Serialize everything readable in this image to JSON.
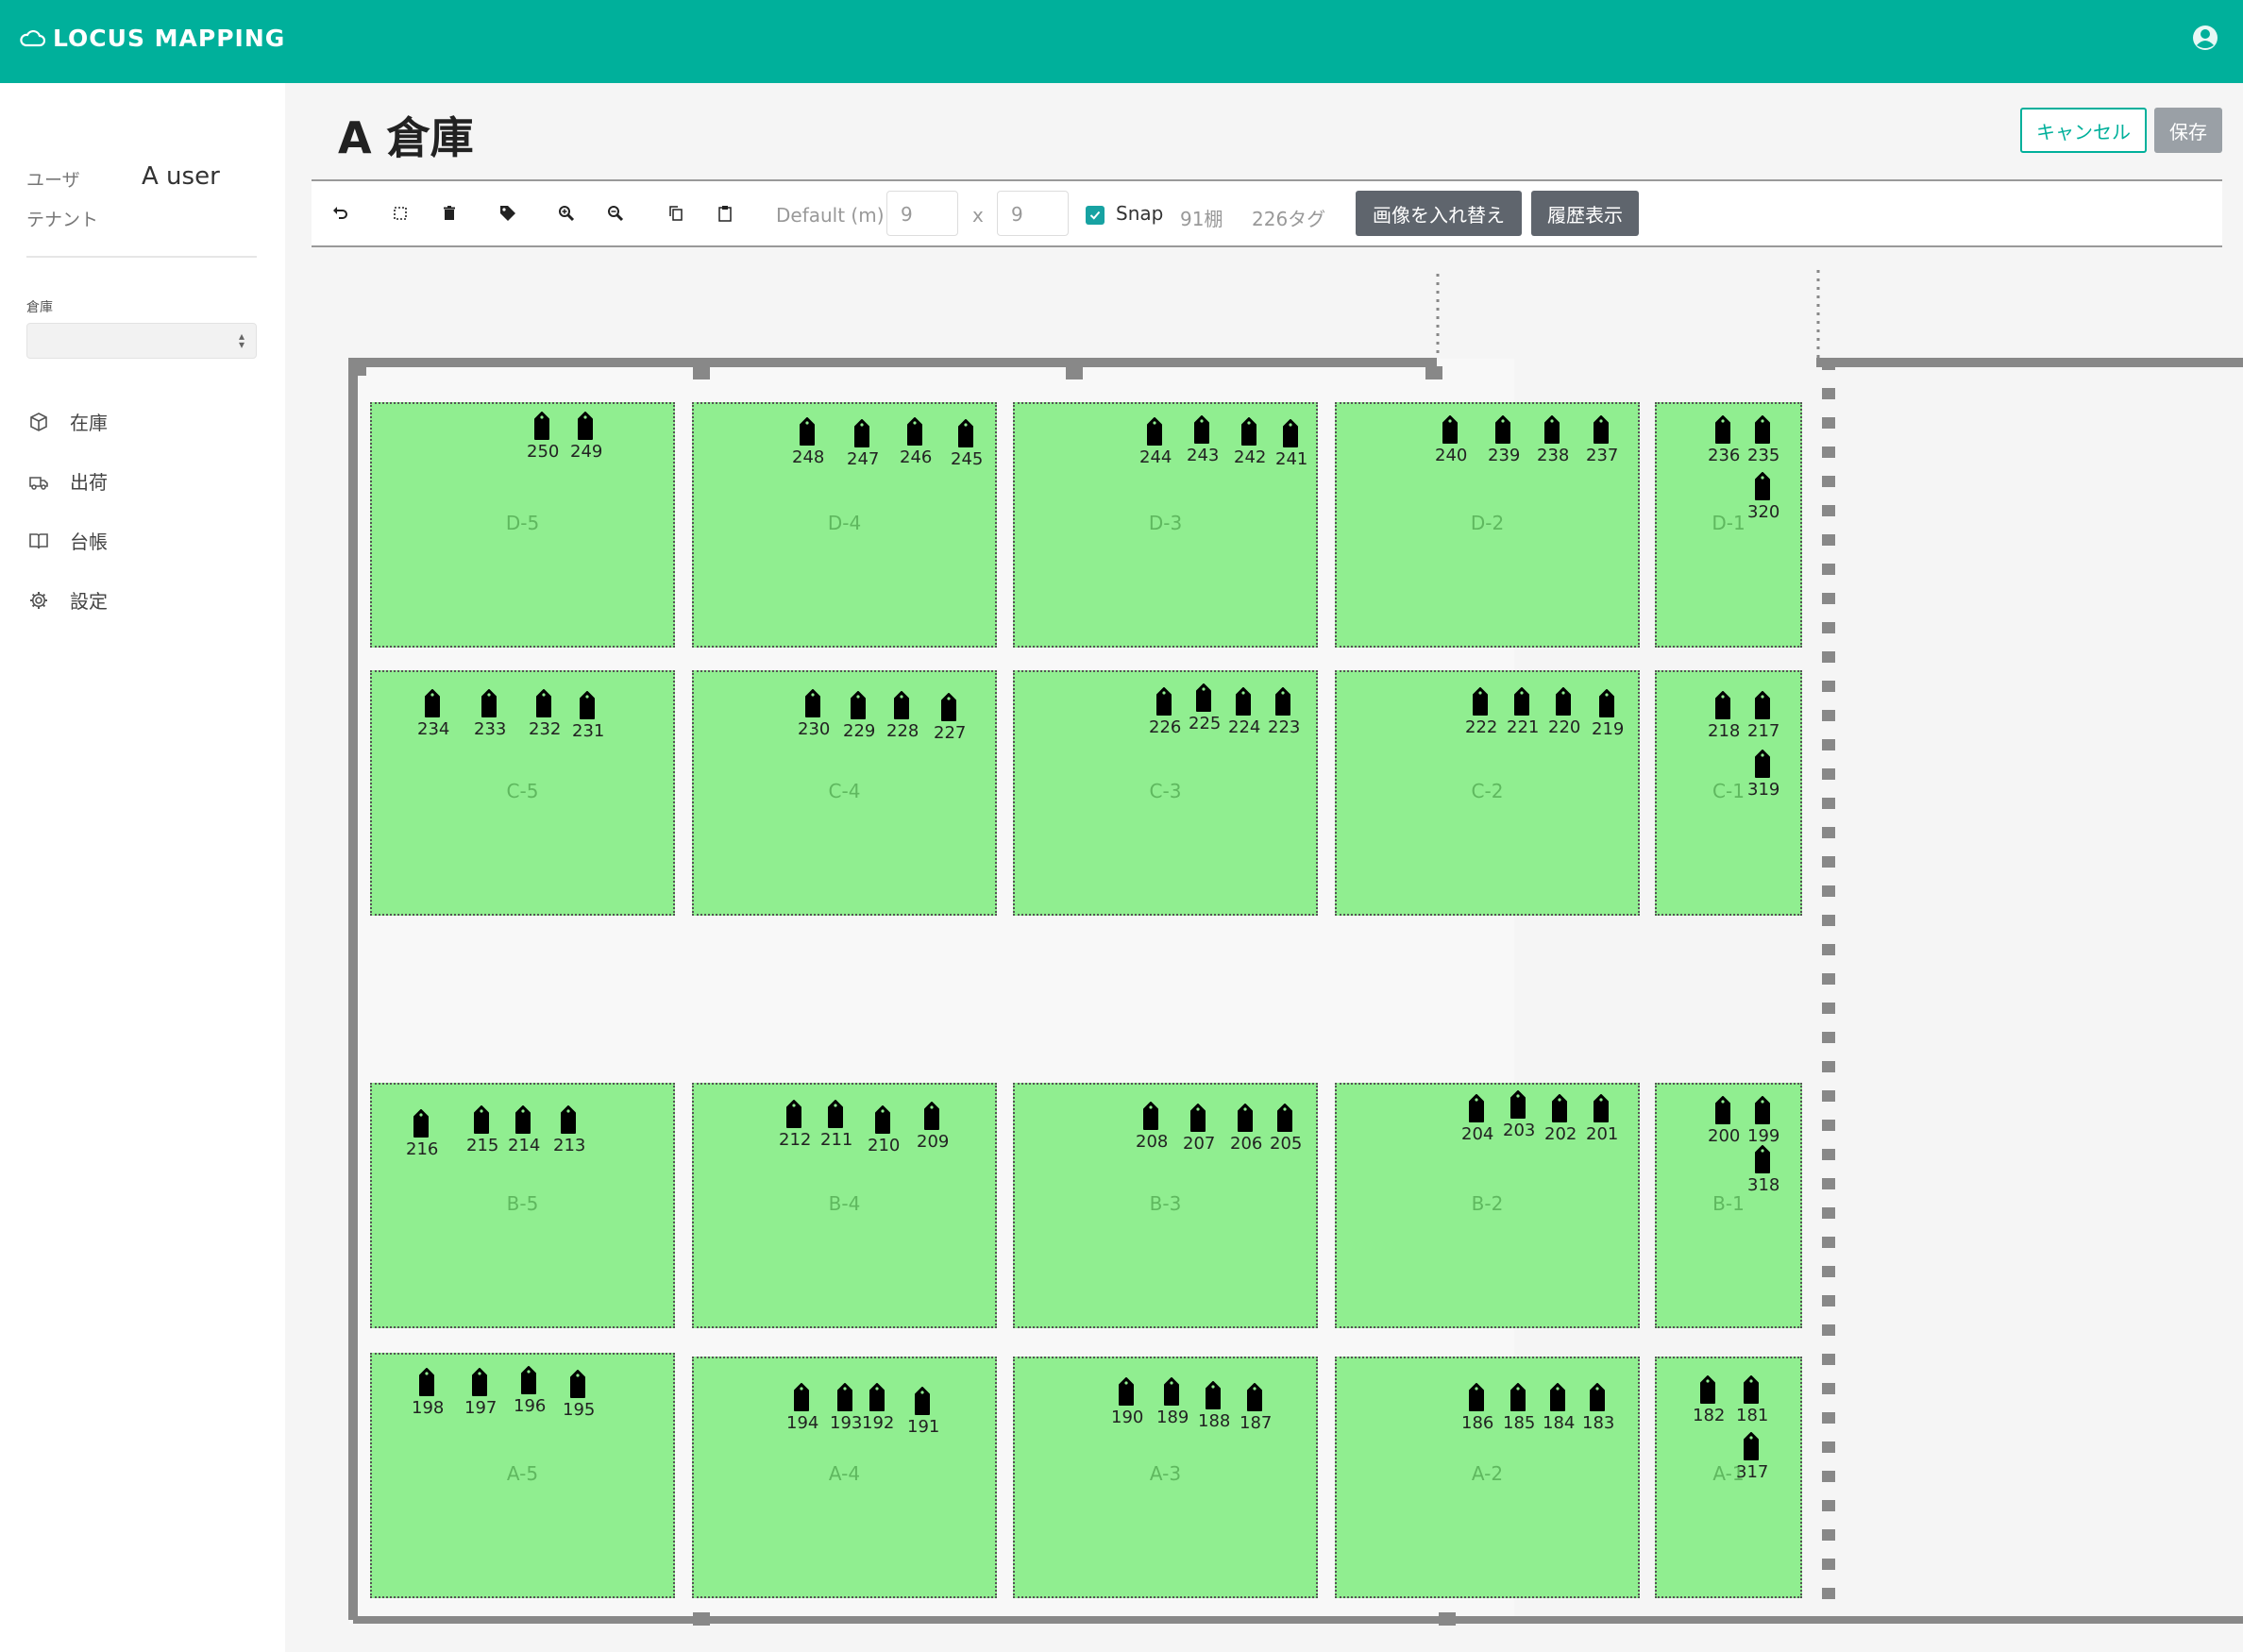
{
  "app": {
    "brand": "LOCUS MAPPING"
  },
  "sidebar": {
    "user_label": "ユーザ",
    "user_value": "A user",
    "tenant_label": "テナント",
    "warehouse_label": "倉庫",
    "warehouse_selected": "",
    "nav": [
      {
        "label": "在庫",
        "icon": "box-icon"
      },
      {
        "label": "出荷",
        "icon": "truck-icon"
      },
      {
        "label": "台帳",
        "icon": "book-icon"
      },
      {
        "label": "設定",
        "icon": "gear-icon"
      }
    ]
  },
  "header": {
    "title": "A 倉庫",
    "cancel_label": "キャンセル",
    "save_label": "保存"
  },
  "toolbar": {
    "default_label": "Default (m)",
    "width_value": "9",
    "x_label": "x",
    "height_value": "9",
    "snap_label": "Snap",
    "snap_checked": true,
    "shelf_count": "91棚",
    "tag_count": "226タグ",
    "replace_image_label": "画像を入れ替え",
    "history_label": "履歴表示"
  },
  "shelves": [
    {
      "name": "D-5",
      "tags": [
        "250",
        "249"
      ]
    },
    {
      "name": "D-4",
      "tags": [
        "248",
        "247",
        "246",
        "245"
      ]
    },
    {
      "name": "D-3",
      "tags": [
        "244",
        "243",
        "242",
        "241"
      ]
    },
    {
      "name": "D-2",
      "tags": [
        "240",
        "239",
        "238",
        "237"
      ]
    },
    {
      "name": "D-1",
      "tags": [
        "236",
        "235",
        "320"
      ]
    },
    {
      "name": "C-5",
      "tags": [
        "234",
        "233",
        "232",
        "231"
      ]
    },
    {
      "name": "C-4",
      "tags": [
        "230",
        "229",
        "228",
        "227"
      ]
    },
    {
      "name": "C-3",
      "tags": [
        "226",
        "225",
        "224",
        "223"
      ]
    },
    {
      "name": "C-2",
      "tags": [
        "222",
        "221",
        "220",
        "219"
      ]
    },
    {
      "name": "C-1",
      "tags": [
        "218",
        "217",
        "319"
      ]
    },
    {
      "name": "B-5",
      "tags": [
        "216",
        "215",
        "214",
        "213"
      ]
    },
    {
      "name": "B-4",
      "tags": [
        "212",
        "211",
        "210",
        "209"
      ]
    },
    {
      "name": "B-3",
      "tags": [
        "208",
        "207",
        "206",
        "205"
      ]
    },
    {
      "name": "B-2",
      "tags": [
        "204",
        "203",
        "202",
        "201"
      ]
    },
    {
      "name": "B-1",
      "tags": [
        "200",
        "199",
        "318"
      ]
    },
    {
      "name": "A-5",
      "tags": [
        "198",
        "197",
        "196",
        "195"
      ]
    },
    {
      "name": "A-4",
      "tags": [
        "194",
        "193",
        "192",
        "191"
      ]
    },
    {
      "name": "A-3",
      "tags": [
        "190",
        "189",
        "188",
        "187"
      ]
    },
    {
      "name": "A-2",
      "tags": [
        "186",
        "185",
        "184",
        "183"
      ]
    },
    {
      "name": "A-1",
      "tags": [
        "182",
        "181",
        "317"
      ]
    }
  ]
}
